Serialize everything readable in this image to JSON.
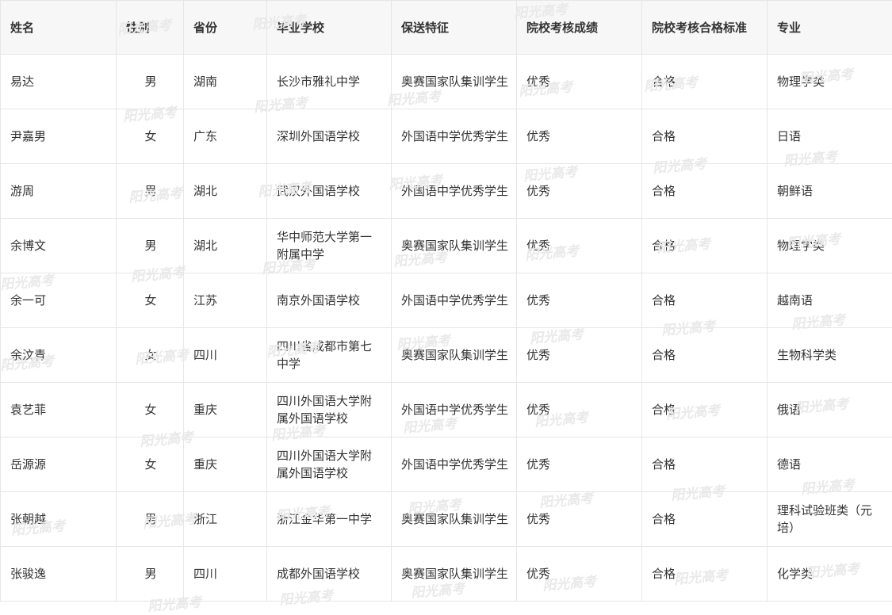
{
  "table": {
    "headers": [
      "姓名",
      "性别",
      "省份",
      "毕业学校",
      "保送特征",
      "院校考核成绩",
      "院校考核合格标准",
      "专业"
    ],
    "rows": [
      [
        "易达",
        "男",
        "湖南",
        "长沙市雅礼中学",
        "奥赛国家队集训学生",
        "优秀",
        "合格",
        "物理学类"
      ],
      [
        "尹嘉男",
        "女",
        "广东",
        "深圳外国语学校",
        "外国语中学优秀学生",
        "优秀",
        "合格",
        "日语"
      ],
      [
        "游周",
        "男",
        "湖北",
        "武汉外国语学校",
        "外国语中学优秀学生",
        "优秀",
        "合格",
        "朝鲜语"
      ],
      [
        "余博文",
        "男",
        "湖北",
        "华中师范大学第一附属中学",
        "奥赛国家队集训学生",
        "优秀",
        "合格",
        "物理学类"
      ],
      [
        "余一可",
        "女",
        "江苏",
        "南京外国语学校",
        "外国语中学优秀学生",
        "优秀",
        "合格",
        "越南语"
      ],
      [
        "余汶青",
        "女",
        "四川",
        "四川省成都市第七中学",
        "奥赛国家队集训学生",
        "优秀",
        "合格",
        "生物科学类"
      ],
      [
        "袁艺菲",
        "女",
        "重庆",
        "四川外国语大学附属外国语学校",
        "外国语中学优秀学生",
        "优秀",
        "合格",
        "俄语"
      ],
      [
        "岳源源",
        "女",
        "重庆",
        "四川外国语大学附属外国语学校",
        "外国语中学优秀学生",
        "优秀",
        "合格",
        "德语"
      ],
      [
        "张朝越",
        "男",
        "浙江",
        "浙江金华第一中学",
        "奥赛国家队集训学生",
        "优秀",
        "合格",
        "理科试验班类（元培）"
      ],
      [
        "张骏逸",
        "男",
        "四川",
        "成都外国语学校",
        "奥赛国家队集训学生",
        "优秀",
        "合格",
        "化学类"
      ]
    ]
  },
  "watermark": {
    "text": "阳光高考"
  }
}
